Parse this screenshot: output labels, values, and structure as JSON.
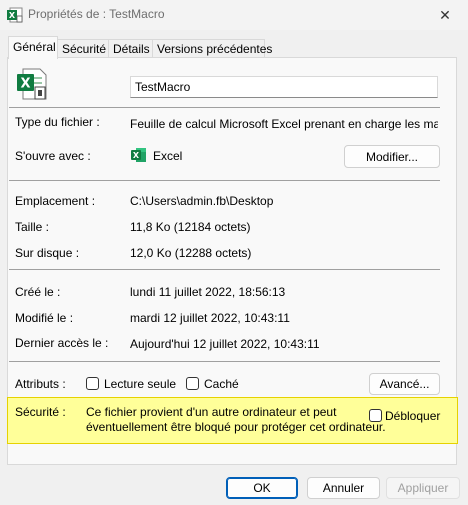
{
  "window": {
    "title": "Propriétés de : TestMacro",
    "close_glyph": "✕"
  },
  "tabs": [
    {
      "label": "Général",
      "active": true
    },
    {
      "label": "Sécurité",
      "active": false
    },
    {
      "label": "Détails",
      "active": false
    },
    {
      "label": "Versions précédentes",
      "active": false
    }
  ],
  "general": {
    "file_name": "TestMacro",
    "type_label": "Type du fichier :",
    "type_value": "Feuille de calcul Microsoft Excel prenant en charge les macros (.x",
    "opens_with_label": "S'ouvre avec :",
    "opens_with_app": "Excel",
    "change_button": "Modifier...",
    "location_label": "Emplacement :",
    "location_value": "C:\\Users\\admin.fb\\Desktop",
    "size_label": "Taille :",
    "size_value": "11,8 Ko (12184 octets)",
    "disk_size_label": "Sur disque :",
    "disk_size_value": "12,0 Ko (12288 octets)",
    "created_label": "Créé le :",
    "created_value": "lundi 11 juillet 2022, 18:56:13",
    "modified_label": "Modifié le :",
    "modified_value": "mardi 12 juillet 2022, 10:43:11",
    "accessed_label": "Dernier accès le :",
    "accessed_value": "Aujourd'hui 12 juillet 2022, 10:43:11",
    "attributes_label": "Attributs :",
    "readonly_label": "Lecture seule",
    "hidden_label": "Caché",
    "advanced_button": "Avancé...",
    "security_label": "Sécurité :",
    "security_text_1": "Ce fichier provient d'un autre ordinateur et peut",
    "security_text_2": "éventuellement être bloqué pour protéger cet ordinateur.",
    "unblock_label": "Débloquer"
  },
  "footer": {
    "ok": "OK",
    "cancel": "Annuler",
    "apply": "Appliquer"
  },
  "colors": {
    "excel_green": "#107c41",
    "warning_bg": "#ffff99",
    "accent": "#005fb8"
  }
}
